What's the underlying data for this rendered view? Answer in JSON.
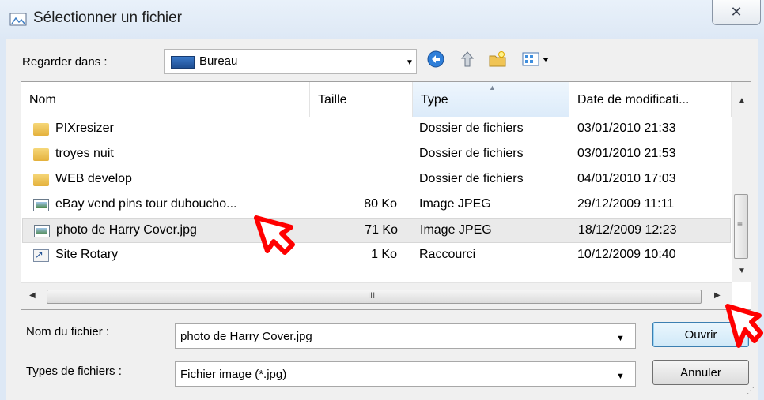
{
  "window": {
    "title": "Sélectionner un fichier",
    "close_label": "✕"
  },
  "lookin": {
    "label": "Regarder dans :",
    "value": "Bureau"
  },
  "columns": {
    "name": "Nom",
    "size": "Taille",
    "type": "Type",
    "date": "Date de modificati..."
  },
  "files": [
    {
      "name": "PIXresizer",
      "size": "",
      "type": "Dossier de fichiers",
      "date": "03/01/2010 21:33",
      "icon": "folder-icon"
    },
    {
      "name": "troyes nuit",
      "size": "",
      "type": "Dossier de fichiers",
      "date": "03/01/2010 21:53",
      "icon": "folder-icon"
    },
    {
      "name": "WEB develop",
      "size": "",
      "type": "Dossier de fichiers",
      "date": "04/01/2010 17:03",
      "icon": "folder-icon"
    },
    {
      "name": "eBay vend pins tour duboucho...",
      "size": "80 Ko",
      "type": "Image JPEG",
      "date": "29/12/2009 11:11",
      "icon": "image-file-icon"
    },
    {
      "name": "photo de Harry Cover.jpg",
      "size": "71 Ko",
      "type": "Image JPEG",
      "date": "18/12/2009 12:23",
      "icon": "image-file-icon",
      "selected": true
    },
    {
      "name": "Site Rotary",
      "size": "1 Ko",
      "type": "Raccourci",
      "date": "10/12/2009 10:40",
      "icon": "shortcut-icon"
    }
  ],
  "scroll_glyphs": {
    "grip": "≡",
    "hgrip": "III"
  },
  "filename": {
    "label": "Nom du fichier :",
    "value": "photo de Harry Cover.jpg"
  },
  "filetype": {
    "label": "Types de fichiers :",
    "value": "Fichier image (*.jpg)"
  },
  "buttons": {
    "open": "Ouvrir",
    "cancel": "Annuler"
  },
  "colors": {
    "pointer": "#ff0000",
    "titlebar": "#dde8f5"
  }
}
